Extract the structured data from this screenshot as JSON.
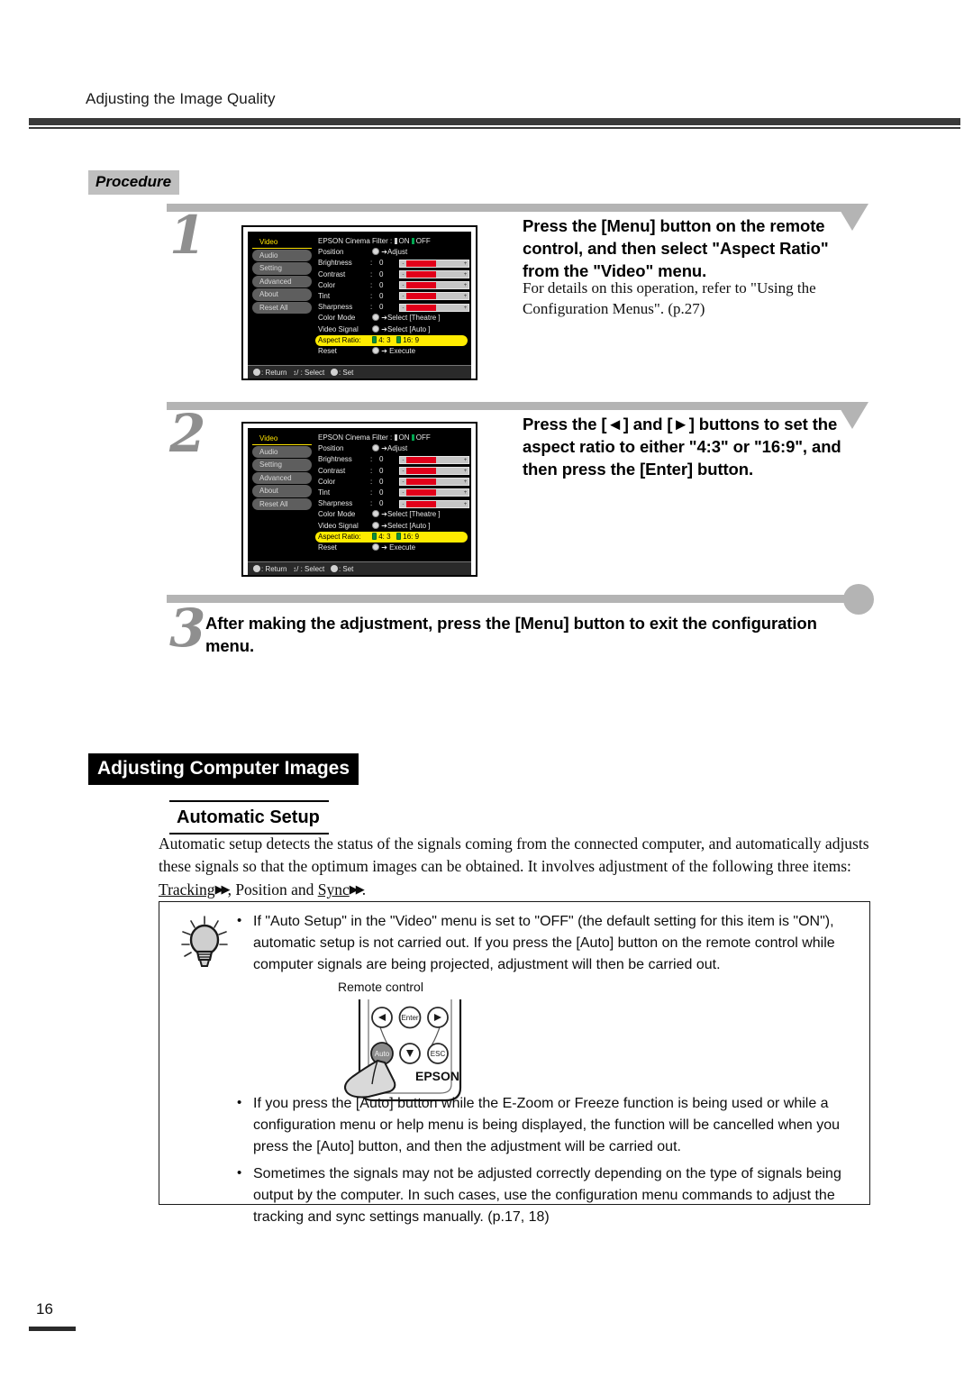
{
  "header": {
    "running_title": "Adjusting the Image Quality"
  },
  "procedure_label": "Procedure",
  "steps": [
    {
      "number": "1",
      "heading": "Press the [Menu] button on the remote control, and then select \"Aspect Ratio\" from the \"Video\" menu.",
      "sub": "For details on this operation, refer to \"Using the Configuration Menus\". (p.27)"
    },
    {
      "number": "2",
      "heading": "Press the [◄] and [►] buttons to set the aspect ratio to either \"4:3\" or \"16:9\", and then press the [Enter] button.",
      "sub": ""
    },
    {
      "number": "3",
      "heading": "After making the adjustment, press the [Menu] button to exit the configuration menu.",
      "sub": ""
    }
  ],
  "osd": {
    "sidebar": [
      "Video",
      "Audio",
      "Setting",
      "Advanced",
      "About",
      "Reset All"
    ],
    "selected_sidebar": "Video",
    "rows": [
      {
        "label": "EPSON Cinema Filter",
        "colon": ":",
        "type": "toggle",
        "options": [
          "ON",
          "OFF"
        ],
        "selected": "OFF"
      },
      {
        "label": "Position",
        "type": "action",
        "action": "Adjust"
      },
      {
        "label": "Brightness",
        "colon": ":",
        "type": "slider",
        "value": "0",
        "fill": 52
      },
      {
        "label": "Contrast",
        "colon": ":",
        "type": "slider",
        "value": "0",
        "fill": 52
      },
      {
        "label": "Color",
        "colon": ":",
        "type": "slider",
        "value": "0",
        "fill": 52
      },
      {
        "label": "Tint",
        "colon": ":",
        "type": "slider",
        "value": "0",
        "fill": 52
      },
      {
        "label": "Sharpness",
        "colon": ":",
        "type": "slider",
        "value": "0",
        "fill": 52
      },
      {
        "label": "Color Mode",
        "type": "select",
        "action": "Select [Theatre        ]"
      },
      {
        "label": "Video Signal",
        "type": "select",
        "action": "Select [Auto      ]"
      },
      {
        "label": "Aspect Ratio:",
        "type": "highlight",
        "options": [
          "4: 3",
          "16: 9"
        ]
      },
      {
        "label": "Reset",
        "type": "action",
        "action": "Execute"
      }
    ],
    "footer": {
      "return": ": Return",
      "select": "/ : Select",
      "set": ": Set"
    }
  },
  "section": {
    "title": "Adjusting Computer Images",
    "subtitle": "Automatic Setup",
    "paragraph_1": "Automatic setup detects the status of the signals coming from the connected computer, and automatically adjusts these signals so that the optimum images can be obtained. It involves adjustment of the following three items: ",
    "keyword_1": "Tracking",
    "paragraph_mid": ", Position and ",
    "keyword_2": "Sync",
    "paragraph_end": "."
  },
  "tips": {
    "icon": "lightbulb-icon",
    "items": [
      "If \"Auto Setup\" in the \"Video\" menu is set to \"OFF\" (the default setting for this item is \"ON\"), automatic setup is not carried out. If you press the [Auto] button on the remote control while computer signals are being projected, adjustment will then be carried out.",
      "If you press the [Auto] button while the E-Zoom or Freeze function is being used or while a configuration menu or help menu is being displayed, the function will be cancelled when you press the [Auto] button, and then the adjustment will be carried out.",
      "Sometimes the signals may not be adjusted correctly depending on the type of signals being output by the computer. In such cases, use the configuration menu commands to adjust the tracking and sync settings manually. (p.17, 18)"
    ]
  },
  "remote": {
    "caption": "Remote control",
    "buttons": [
      "◄",
      "Enter",
      "►",
      "Auto",
      "▼",
      "ESC"
    ],
    "pressed_button": "Auto",
    "brand": "EPSON"
  },
  "footer": {
    "page_number": "16"
  },
  "colors": {
    "highlight": "#ffec00",
    "selected_text": "#ffe400",
    "slider_fill": "#e2001a",
    "rule": "#3a3a3a",
    "step_bar": "#b4b4b4"
  }
}
